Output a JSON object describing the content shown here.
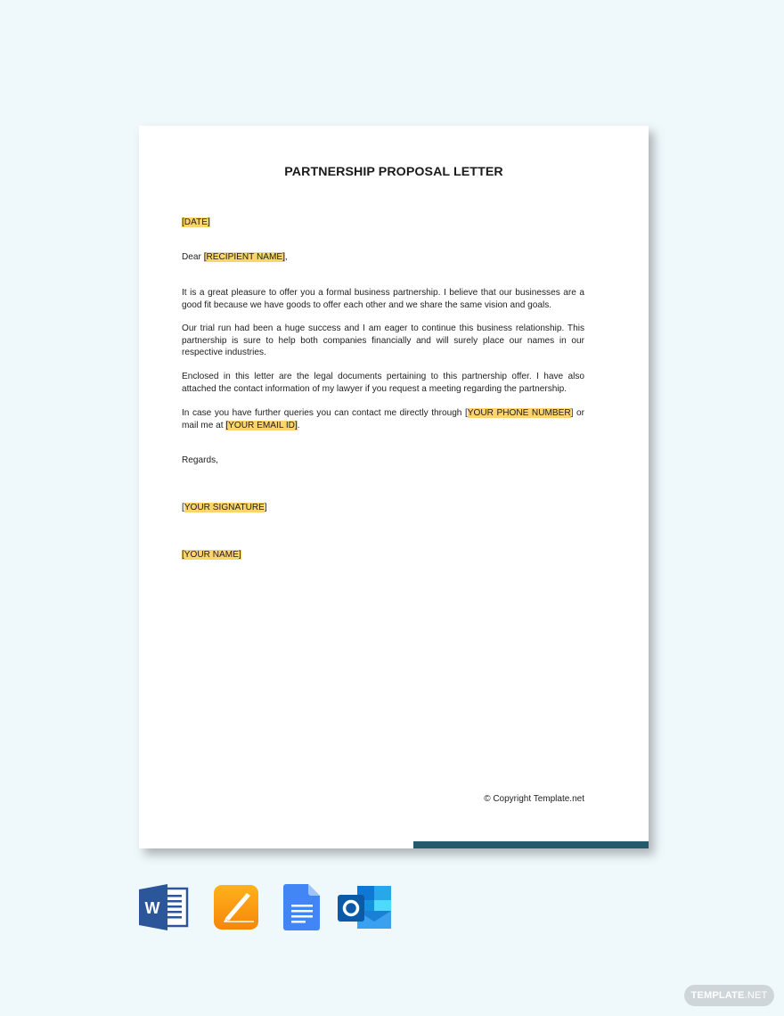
{
  "document": {
    "title": "PARTNERSHIP PROPOSAL LETTER",
    "date_placeholder": "[DATE]",
    "salutation_prefix": "Dear ",
    "recipient_placeholder": "[RECIPIENT NAME]",
    "salutation_suffix": ",",
    "paragraphs": [
      "It is a great pleasure to offer you a formal business partnership. I believe that our businesses are a good fit because we have goods to offer each other and we share the same vision and goals.",
      "Our trial run had been a huge success and I am eager to continue this business relationship. This partnership is sure to help both companies financially and will surely place our names in our respective industries.",
      "Enclosed in this letter are the legal documents pertaining to this partnership offer. I have also attached the contact information of my lawyer if you request a meeting regarding the partnership."
    ],
    "contact_paragraph": {
      "prefix": "In case you have further queries  you can contact me directly through [",
      "phone_placeholder": "YOUR PHONE NUMBER",
      "middle": "] or mail me at ",
      "email_placeholder": "[YOUR EMAIL ID]",
      "suffix": "."
    },
    "closing": "Regards,",
    "signature_open": "[",
    "signature_placeholder": "YOUR SIGNATURE",
    "signature_close": "]",
    "name_placeholder": "[YOUR NAME]",
    "copyright": "© Copyright Template.net"
  },
  "colors": {
    "highlight": "#fbd56b",
    "accent_bar": "#245a6b",
    "background": "#eff8fb"
  },
  "format_icons": [
    {
      "name": "microsoft-word-icon",
      "label": "W"
    },
    {
      "name": "apple-pages-icon"
    },
    {
      "name": "google-docs-icon"
    },
    {
      "name": "microsoft-outlook-icon",
      "label": "O"
    }
  ],
  "watermark": {
    "bold": "TEMPLATE",
    "light": ".NET"
  }
}
